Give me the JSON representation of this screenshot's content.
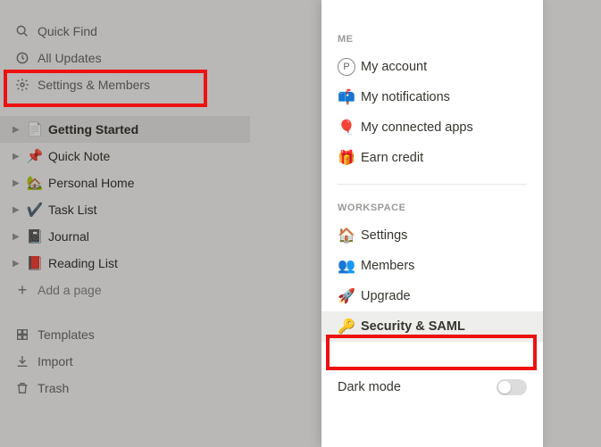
{
  "sidebar": {
    "top": [
      {
        "icon": "search",
        "label": "Quick Find"
      },
      {
        "icon": "clock",
        "label": "All Updates"
      },
      {
        "icon": "gear",
        "label": "Settings & Members"
      }
    ],
    "pages": [
      {
        "emoji": "📄",
        "label": "Getting Started",
        "selected": true,
        "gray": true
      },
      {
        "emoji": "📌",
        "label": "Quick Note"
      },
      {
        "emoji": "🏡",
        "label": "Personal Home"
      },
      {
        "emoji": "✔️",
        "label": "Task List"
      },
      {
        "emoji": "📓",
        "label": "Journal"
      },
      {
        "emoji": "📕",
        "label": "Reading List"
      }
    ],
    "addPage": "Add a page",
    "bottom": [
      {
        "icon": "templates",
        "label": "Templates"
      },
      {
        "icon": "import",
        "label": "Import"
      },
      {
        "icon": "trash",
        "label": "Trash"
      }
    ]
  },
  "panel": {
    "sections": {
      "me": {
        "label": "ME",
        "items": [
          {
            "icon": "avatar",
            "avatarLetter": "P",
            "label": "My account"
          },
          {
            "icon": "📫",
            "label": "My notifications"
          },
          {
            "icon": "🎈",
            "label": "My connected apps"
          },
          {
            "icon": "🎁",
            "label": "Earn credit"
          }
        ]
      },
      "workspace": {
        "label": "WORKSPACE",
        "items": [
          {
            "icon": "🏠",
            "label": "Settings"
          },
          {
            "icon": "👥",
            "label": "Members"
          },
          {
            "icon": "🚀",
            "label": "Upgrade"
          },
          {
            "icon": "🔑",
            "label": "Security & SAML",
            "highlight": true
          }
        ]
      }
    },
    "darkMode": {
      "label": "Dark mode",
      "enabled": false
    }
  }
}
